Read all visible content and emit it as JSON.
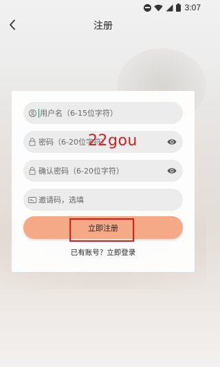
{
  "status_bar": {
    "time": "3:07",
    "icons": [
      "do-not-disturb-icon",
      "wifi-icon",
      "signal-icon",
      "battery-icon"
    ]
  },
  "header": {
    "title": "注册",
    "back_icon": "chevron-left-icon"
  },
  "form": {
    "username_placeholder": "用户名（6-15位字符）",
    "password_placeholder": "密码（6-20位字符）",
    "confirm_password_placeholder": "确认密码（6-20位字符）",
    "invite_code_placeholder": "邀请码，选填",
    "submit_label": "立即注册",
    "login_link": "已有账号？立即登录"
  },
  "watermark": "22gou",
  "colors": {
    "accent_button": "#f5a987",
    "highlight_box": "#e01a1a",
    "watermark": "#d42020",
    "field_bg": "#ececec"
  }
}
